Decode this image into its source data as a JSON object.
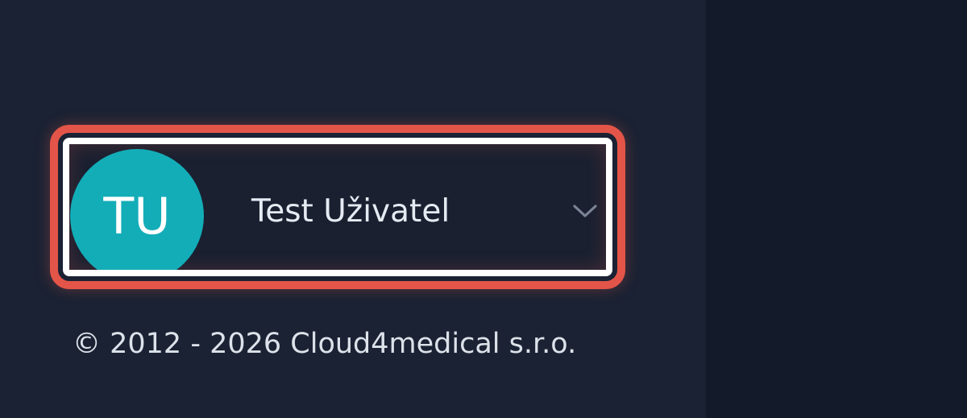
{
  "user": {
    "initials": "TU",
    "name": "Test Uživatel",
    "avatar_color": "#13adb8",
    "menu_icon": "chevron-down-icon"
  },
  "footer": {
    "copyright": "© 2012 - 2026 Cloud4medical s.r.o."
  },
  "colors": {
    "sidebar_background": "#1a2233",
    "main_background": "#131a29",
    "highlight": "#e35548",
    "focus_outline": "#ffffff"
  }
}
